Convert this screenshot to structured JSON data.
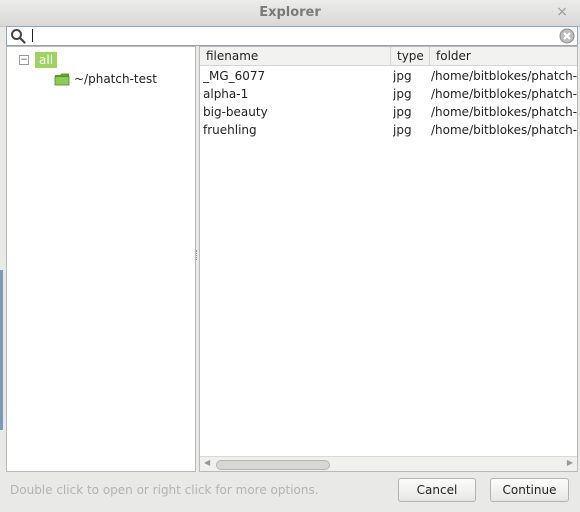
{
  "window": {
    "title": "Explorer"
  },
  "search": {
    "value": "",
    "placeholder": ""
  },
  "tree": {
    "root_label": "all",
    "items": [
      {
        "label": "~/phatch-test"
      }
    ]
  },
  "table": {
    "columns": [
      "filename",
      "type",
      "folder"
    ],
    "rows": [
      {
        "filename": "_MG_6077",
        "type": "jpg",
        "folder": "/home/bitblokes/phatch-t"
      },
      {
        "filename": "alpha-1",
        "type": "jpg",
        "folder": "/home/bitblokes/phatch-t"
      },
      {
        "filename": "big-beauty",
        "type": "jpg",
        "folder": "/home/bitblokes/phatch-t"
      },
      {
        "filename": "fruehling",
        "type": "jpg",
        "folder": "/home/bitblokes/phatch-t"
      }
    ]
  },
  "status_text": "Double click to open or right click for more options.",
  "buttons": {
    "cancel": "Cancel",
    "continue": "Continue"
  },
  "colors": {
    "selection": "#9cd45f",
    "folder": "#7bbd3f"
  }
}
